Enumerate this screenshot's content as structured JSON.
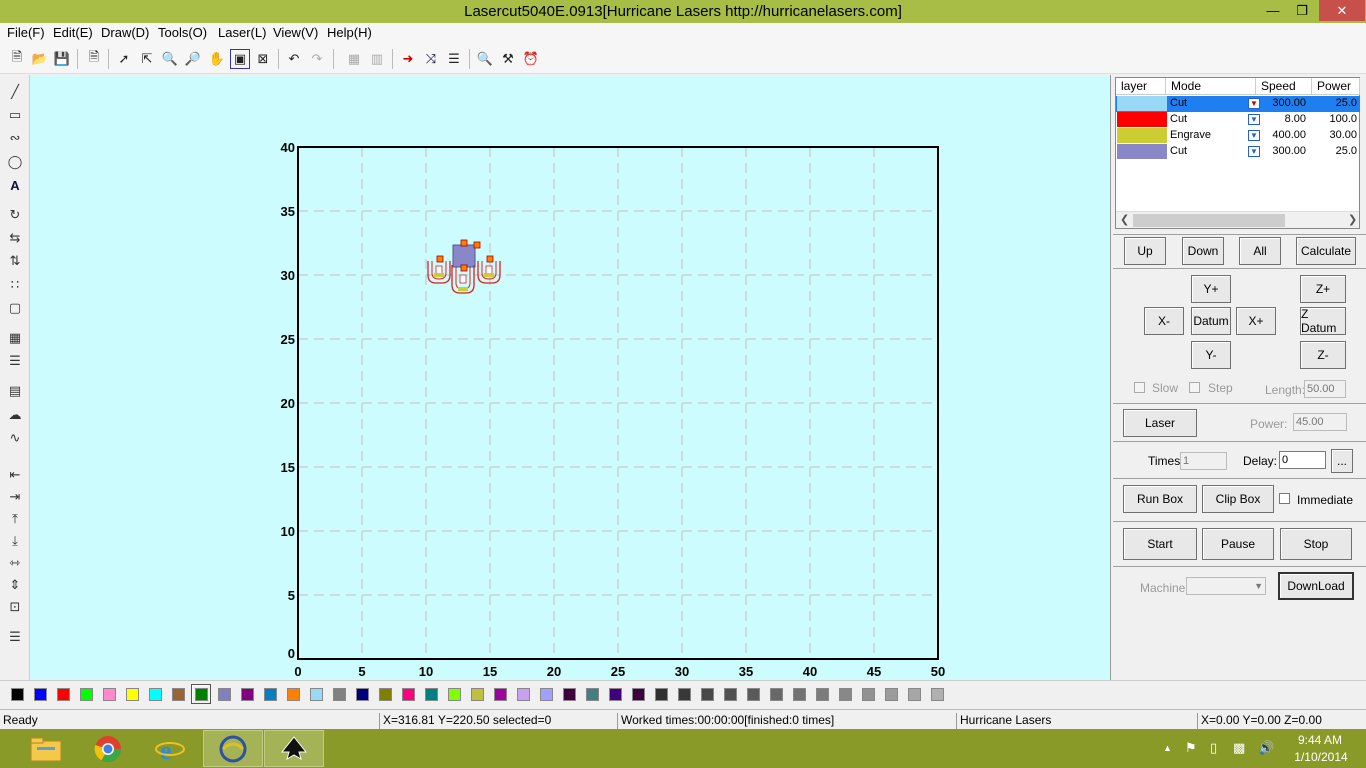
{
  "window": {
    "title": "Lasercut5040E.0913[Hurricane Lasers http://hurricanelasers.com]",
    "minimize": "—",
    "maximize": "❐",
    "close": "✕"
  },
  "menu": [
    "File(F)",
    "Edit(E)",
    "Draw(D)",
    "Tools(O)",
    "Laser(L)",
    "View(V)",
    "Help(H)"
  ],
  "canvas": {
    "background": "#ccfcfd",
    "x_ticks": [
      "0",
      "5",
      "10",
      "15",
      "20",
      "25",
      "30",
      "35",
      "40",
      "45",
      "50"
    ],
    "y_ticks": [
      "0",
      "5",
      "10",
      "15",
      "20",
      "25",
      "30",
      "35",
      "40"
    ]
  },
  "layers": {
    "headers": [
      "layer",
      "Mode",
      "Speed",
      "Power"
    ],
    "rows": [
      {
        "color": "#99d8f6",
        "mode": "Cut",
        "speed": "300.00",
        "power": "25.0",
        "selected": true
      },
      {
        "color": "#ff0000",
        "mode": "Cut",
        "speed": "8.00",
        "power": "100.0",
        "selected": false
      },
      {
        "color": "#cccc33",
        "mode": "Engrave",
        "speed": "400.00",
        "power": "30.00",
        "selected": false
      },
      {
        "color": "#8a87c8",
        "mode": "Cut",
        "speed": "300.00",
        "power": "25.0",
        "selected": false
      }
    ]
  },
  "layer_buttons": {
    "up": "Up",
    "down": "Down",
    "all": "All",
    "calculate": "Calculate"
  },
  "jog": {
    "y_plus": "Y+",
    "y_minus": "Y-",
    "x_minus": "X-",
    "x_plus": "X+",
    "datum": "Datum",
    "z_plus": "Z+",
    "z_datum": "Z Datum",
    "z_minus": "Z-",
    "slow": "Slow",
    "step": "Step",
    "length_label": "Length:",
    "length_value": "50.00"
  },
  "laser": {
    "button": "Laser",
    "power_label": "Power:",
    "power_value": "45.00"
  },
  "times": {
    "times_label": "Times:",
    "times_value": "1",
    "delay_label": "Delay:",
    "delay_value": "0",
    "more": "..."
  },
  "box": {
    "run_box": "Run Box",
    "clip_box": "Clip Box",
    "immediate": "Immediate"
  },
  "control": {
    "start": "Start",
    "pause": "Pause",
    "stop": "Stop"
  },
  "machine": {
    "label": "Machine:",
    "download": "DownLoad"
  },
  "palette": [
    "#000000",
    "#0000ff",
    "#ff0000",
    "#00ff00",
    "#ff88cc",
    "#ffff00",
    "#00ffff",
    "#996633",
    "#008000",
    "#8080c0",
    "#800080",
    "#0080c0",
    "#ff8000",
    "#99d8f6",
    "#808080",
    "#000080",
    "#808000",
    "#ff0080",
    "#008080",
    "#80ff00",
    "#c0c040",
    "#a000a0",
    "#c8a0f0",
    "#a0a0ff",
    "#400040",
    "#408080",
    "#400080",
    "#400040",
    "#303030",
    "#383838",
    "#484848",
    "#505050",
    "#5a5a5a",
    "#686868",
    "#727272",
    "#7c7c7c",
    "#888888",
    "#929292",
    "#9c9c9c",
    "#a6a6a6",
    "#b0b0b0"
  ],
  "status": {
    "ready": "Ready",
    "coords": "X=316.81 Y=220.50 selected=0",
    "worked": "Worked times:00:00:00[finished:0 times]",
    "company": "Hurricane Lasers",
    "position": "X=0.00 Y=0.00 Z=0.00"
  },
  "taskbar": {
    "time": "9:44 AM",
    "date": "1/10/2014"
  }
}
